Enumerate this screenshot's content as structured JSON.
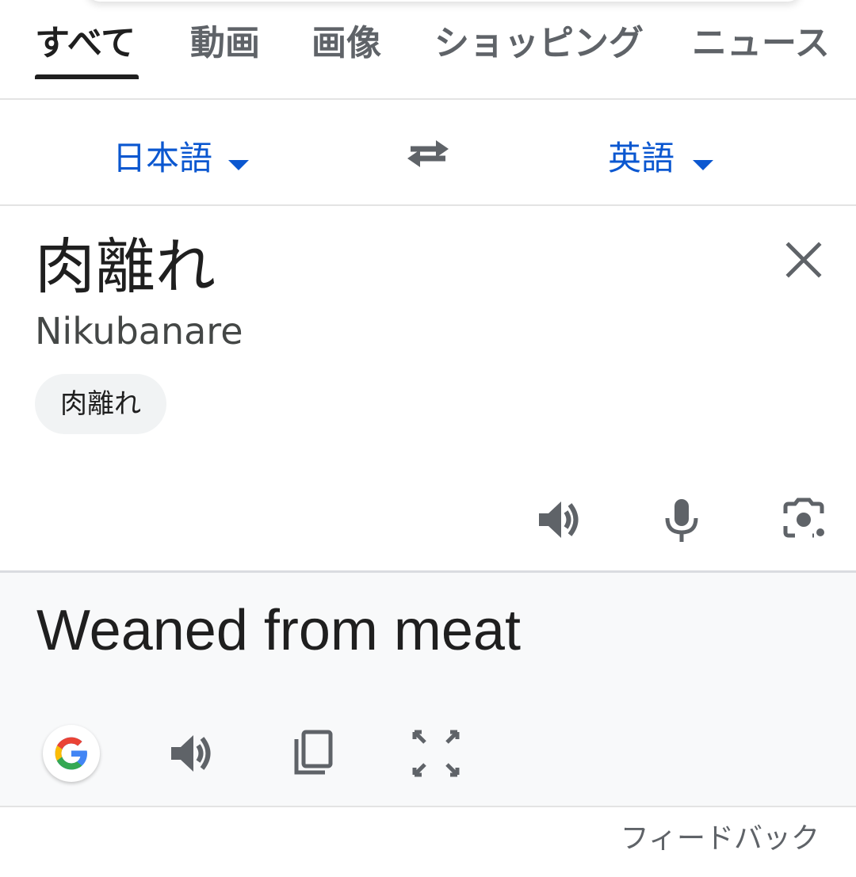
{
  "tabs": [
    {
      "label": "すべて",
      "active": true
    },
    {
      "label": "動画",
      "active": false
    },
    {
      "label": "画像",
      "active": false
    },
    {
      "label": "ショッピング",
      "active": false
    },
    {
      "label": "ニュース",
      "active": false
    }
  ],
  "languages": {
    "source": "日本語",
    "target": "英語",
    "swap_icon": "swap-arrows-icon"
  },
  "source": {
    "text": "肉離れ",
    "romanization": "Nikubanare",
    "suggestion_chip": "肉離れ",
    "icons": [
      "clear-icon",
      "speaker-icon",
      "microphone-icon",
      "camera-icon"
    ]
  },
  "target": {
    "text": "Weaned from meat",
    "icons": [
      "google-icon",
      "speaker-icon",
      "copy-icon",
      "fullscreen-icon"
    ]
  },
  "footer": {
    "feedback_label": "フィードバック"
  },
  "colors": {
    "accent_blue": "#0b57d0",
    "text_primary": "#1f1f1f",
    "text_secondary": "#5f6368",
    "target_panel_bg": "#f8f9fa"
  }
}
